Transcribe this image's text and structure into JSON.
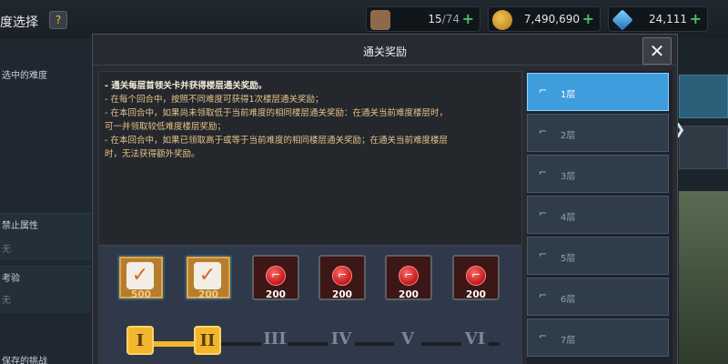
{
  "background": {
    "title": "度选择",
    "help_label": "?",
    "left_labels": {
      "selected_difficulty": "选中的难度",
      "banned_attr": "禁止属性",
      "banned_attr_value": "无",
      "trial": "考验",
      "trial_value": "无",
      "saved": "保存的挑战"
    },
    "resources": {
      "stamina_current": "15",
      "stamina_max": "/74",
      "gold": "7,490,690",
      "gems": "24,111",
      "plus": "+"
    },
    "side_arrow": "❯"
  },
  "modal": {
    "title": "通关奖励",
    "close": "✕",
    "rules": [
      "- 通关每层首领关卡并获得楼层通关奖励。",
      "- 在每个回合中，按照不同难度可获得1次楼层通关奖励；",
      "- 在本回合中，如果尚未领取低于当前难度的相同楼层通关奖励：在通关当前难度楼层时，",
      "可一并领取较低难度楼层奖励；",
      "- 在本回合中，如果已领取高于或等于当前难度的相同楼层通关奖励；在通关当前难度楼层",
      "时，无法获得额外奖励。"
    ],
    "rewards": [
      {
        "amount": "500",
        "claimed": true
      },
      {
        "amount": "200",
        "claimed": true
      },
      {
        "amount": "200",
        "claimed": false
      },
      {
        "amount": "200",
        "claimed": false
      },
      {
        "amount": "200",
        "claimed": false
      },
      {
        "amount": "200",
        "claimed": false
      }
    ],
    "check_glyph": "✓",
    "difficulties": [
      "I",
      "II",
      "III",
      "IV",
      "V",
      "VI"
    ],
    "difficulties_reached": 2,
    "floors": [
      "1层",
      "2层",
      "3层",
      "4层",
      "5层",
      "6层",
      "7层"
    ],
    "selected_floor": "1层",
    "stair_glyph": "⌐"
  },
  "colors": {
    "accent_gold": "#f2b62d",
    "selected_blue": "#3e9ddc",
    "rule_text": "#e6c38a"
  }
}
